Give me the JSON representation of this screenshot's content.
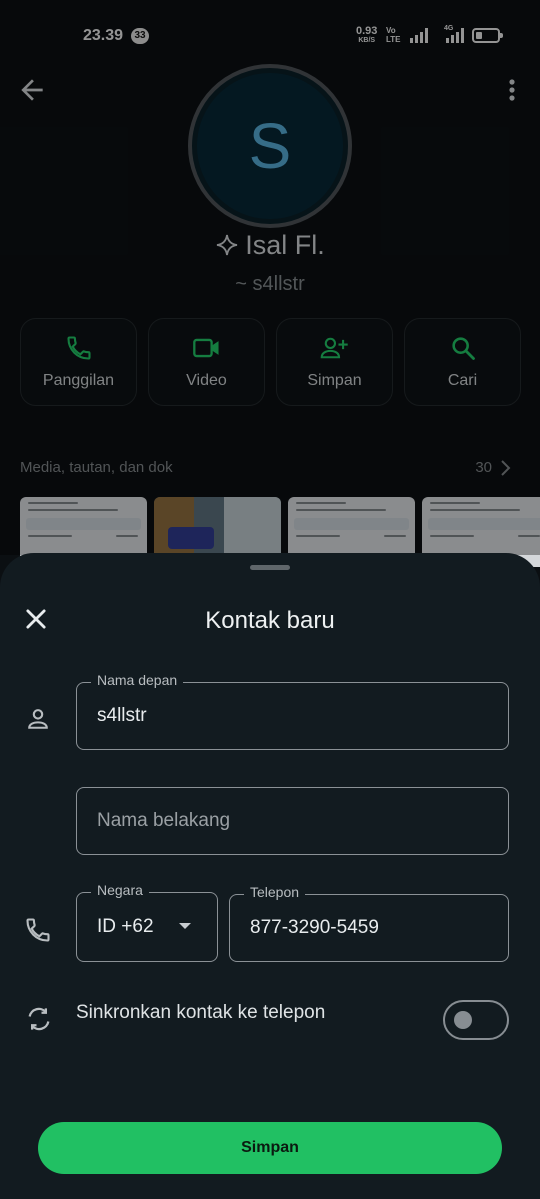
{
  "status_bar": {
    "time": "23.39",
    "notification_count": "33",
    "net_speed": "0.93",
    "net_speed_unit": "KB/S",
    "volte_top": "Vo",
    "volte_bottom": "LTE",
    "network_type": "4G",
    "battery_level": 0.25
  },
  "profile": {
    "avatar_letter": "S",
    "name": "Isal Fl.",
    "username": "~ s4llstr",
    "accent_color": "#21c063",
    "avatar_letter_color": "#53a6cf"
  },
  "actions": [
    {
      "label": "Panggilan",
      "icon": "phone-icon"
    },
    {
      "label": "Video",
      "icon": "video-icon"
    },
    {
      "label": "Simpan",
      "icon": "add-person-icon"
    },
    {
      "label": "Cari",
      "icon": "search-icon"
    }
  ],
  "media": {
    "title": "Media, tautan, dan dok",
    "count": "30"
  },
  "sheet": {
    "title": "Kontak baru",
    "first_name_label": "Nama depan",
    "first_name_value": "s4llstr",
    "last_name_placeholder": "Nama belakang",
    "country_label": "Negara",
    "country_value": "ID +62",
    "phone_label": "Telepon",
    "phone_value": "877-3290-5459",
    "sync_label": "Sinkronkan kontak ke telepon",
    "sync_enabled": false,
    "save_label": "Simpan"
  }
}
